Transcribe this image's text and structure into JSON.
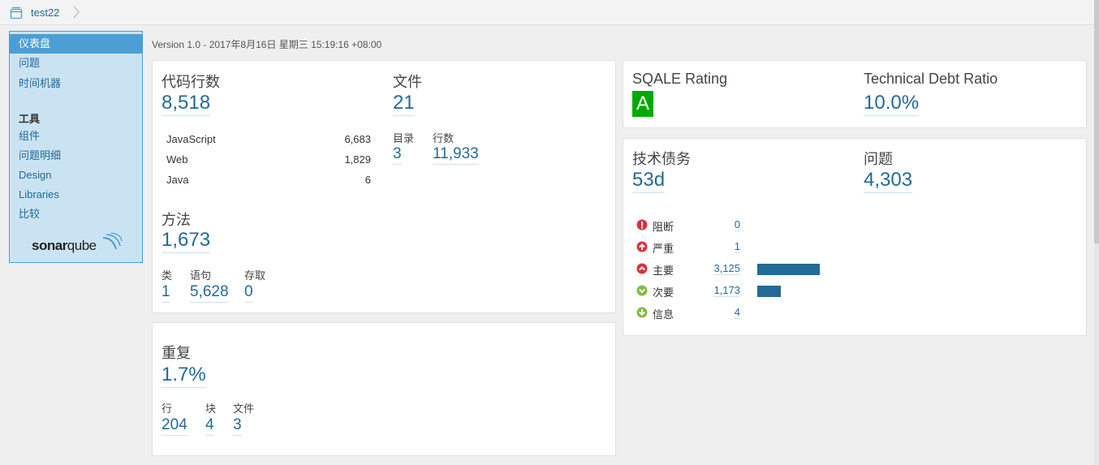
{
  "header": {
    "project_name": "test22"
  },
  "sidebar": {
    "items": [
      {
        "label": "仪表盘",
        "active": true
      },
      {
        "label": "问题"
      },
      {
        "label": "时间机器"
      }
    ],
    "tools_heading": "工具",
    "tools": [
      {
        "label": "组件"
      },
      {
        "label": "问题明细"
      },
      {
        "label": "Design"
      },
      {
        "label": "Libraries"
      },
      {
        "label": "比较"
      }
    ],
    "logo": {
      "part1": "sonar",
      "part2": "qube"
    }
  },
  "version_text": "Version 1.0 - 2017年8月16日 星期三 15:19:16 +08:00",
  "size": {
    "lines_label": "代码行数",
    "lines_value": "8,518",
    "languages": [
      {
        "name": "JavaScript",
        "value": "6,683"
      },
      {
        "name": "Web",
        "value": "1,829"
      },
      {
        "name": "Java",
        "value": "6"
      }
    ],
    "files_label": "文件",
    "files_value": "21",
    "dirs_label": "目录",
    "dirs_value": "3",
    "rows_label": "行数",
    "rows_value": "11,933",
    "methods_label": "方法",
    "methods_value": "1,673",
    "classes_label": "类",
    "classes_value": "1",
    "statements_label": "语句",
    "statements_value": "5,628",
    "accessors_label": "存取",
    "accessors_value": "0"
  },
  "duplications": {
    "label": "重复",
    "value": "1.7%",
    "lines_label": "行",
    "lines_value": "204",
    "blocks_label": "块",
    "blocks_value": "4",
    "files_label": "文件",
    "files_value": "3"
  },
  "sqale": {
    "rating_label": "SQALE Rating",
    "rating_value": "A",
    "rating_color": "#00aa00",
    "debt_ratio_label": "Technical Debt Ratio",
    "debt_ratio_value": "10.0%"
  },
  "debt": {
    "tech_debt_label": "技术债务",
    "tech_debt_value": "53d",
    "issues_label": "问题",
    "issues_value": "4,303",
    "severities": [
      {
        "name": "阻断",
        "count": "0",
        "icon": "blocker-icon",
        "color": "#d4333f",
        "bar_fraction": 0
      },
      {
        "name": "严重",
        "count": "1",
        "icon": "critical-icon",
        "color": "#d4333f",
        "bar_fraction": 0
      },
      {
        "name": "主要",
        "count": "3,125",
        "icon": "major-icon",
        "color": "#d4333f",
        "bar_fraction": 1.0
      },
      {
        "name": "次要",
        "count": "1,173",
        "icon": "minor-icon",
        "color": "#85bb43",
        "bar_fraction": 0.375
      },
      {
        "name": "信息",
        "count": "4",
        "icon": "info-icon",
        "color": "#85bb43",
        "bar_fraction": 0
      }
    ]
  }
}
